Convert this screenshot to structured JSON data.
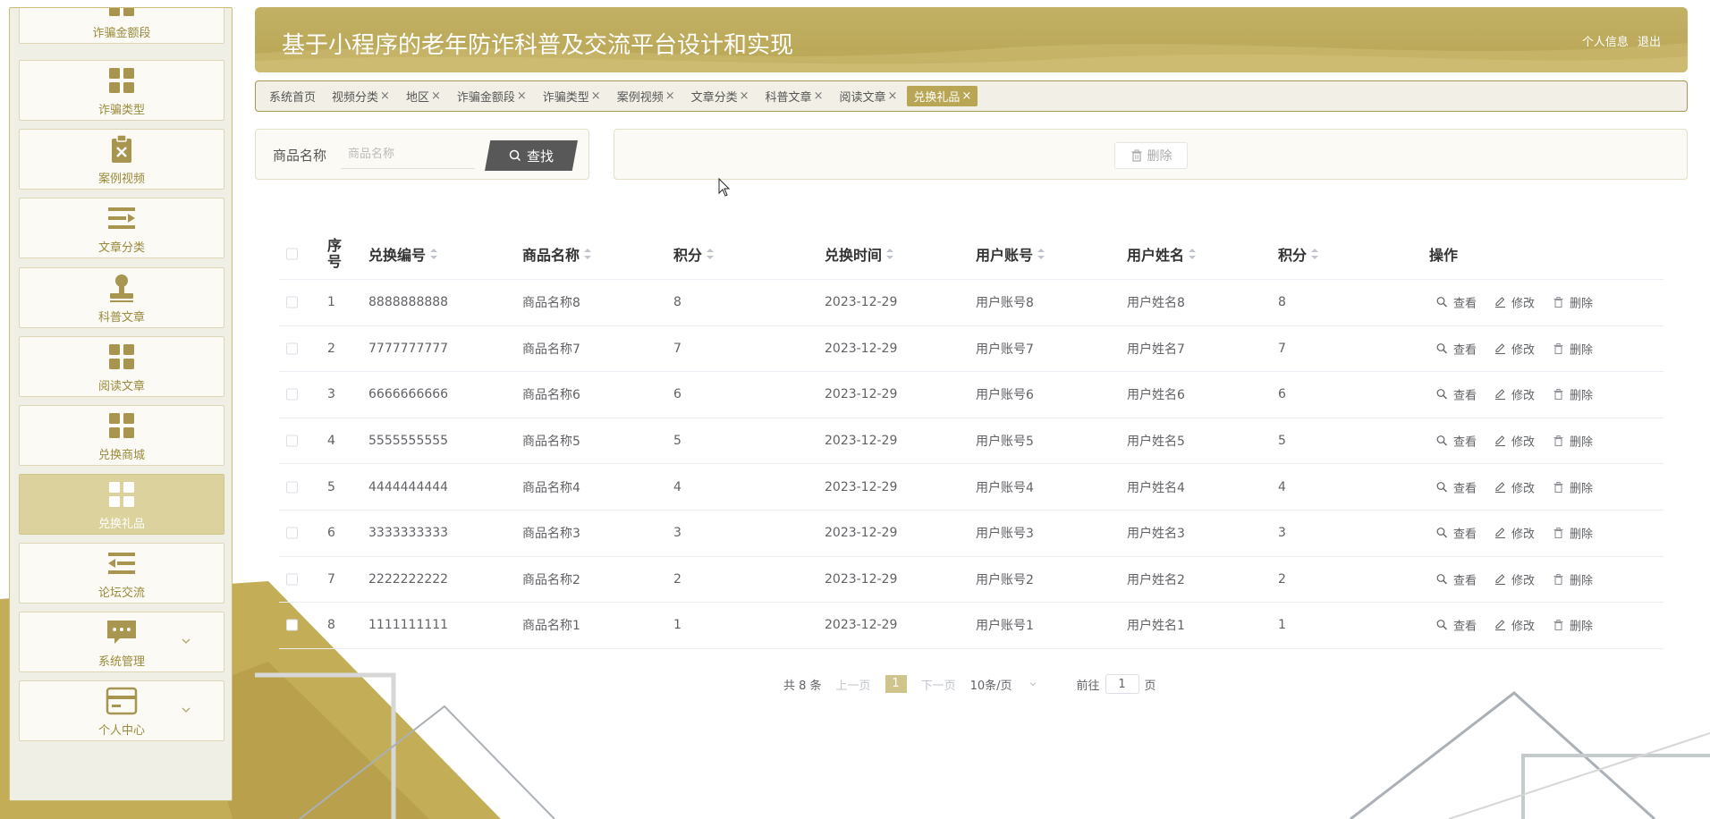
{
  "sidebar": {
    "items": [
      {
        "label": "诈骗金额段",
        "icon": "grid-icon",
        "active": false
      },
      {
        "label": "诈骗类型",
        "icon": "grid-icon",
        "active": false
      },
      {
        "label": "案例视频",
        "icon": "clipboard-x-icon",
        "active": false
      },
      {
        "label": "文章分类",
        "icon": "list-arrow-icon",
        "active": false
      },
      {
        "label": "科普文章",
        "icon": "stamp-icon",
        "active": false
      },
      {
        "label": "阅读文章",
        "icon": "grid-icon",
        "active": false
      },
      {
        "label": "兑换商城",
        "icon": "grid-icon",
        "active": false
      },
      {
        "label": "兑换礼品",
        "icon": "grid-icon",
        "active": true
      },
      {
        "label": "论坛交流",
        "icon": "list-left-arrow-icon",
        "active": false
      },
      {
        "label": "系统管理",
        "icon": "chat-bubble-icon",
        "active": false,
        "expandable": true
      },
      {
        "label": "个人中心",
        "icon": "card-icon",
        "active": false,
        "expandable": true
      }
    ]
  },
  "header": {
    "title": "基于小程序的老年防诈科普及交流平台设计和实现",
    "profile_link": "个人信息",
    "logout_link": "退出"
  },
  "tabs": [
    {
      "label": "系统首页",
      "closable": false,
      "active": false
    },
    {
      "label": "视频分类",
      "closable": true,
      "active": false
    },
    {
      "label": "地区",
      "closable": true,
      "active": false
    },
    {
      "label": "诈骗金额段",
      "closable": true,
      "active": false
    },
    {
      "label": "诈骗类型",
      "closable": true,
      "active": false
    },
    {
      "label": "案例视频",
      "closable": true,
      "active": false
    },
    {
      "label": "文章分类",
      "closable": true,
      "active": false
    },
    {
      "label": "科普文章",
      "closable": true,
      "active": false
    },
    {
      "label": "阅读文章",
      "closable": true,
      "active": false
    },
    {
      "label": "兑换礼品",
      "closable": true,
      "active": true
    }
  ],
  "search": {
    "label": "商品名称",
    "placeholder": "商品名称",
    "button_label": "查找"
  },
  "actions": {
    "delete_label": "删除"
  },
  "table": {
    "columns": [
      "序号",
      "兑换编号",
      "商品名称",
      "积分",
      "兑换时间",
      "用户账号",
      "用户姓名",
      "积分",
      "操作"
    ],
    "rows": [
      {
        "index": "1",
        "code": "8888888888",
        "product": "商品名称8",
        "points": "8",
        "time": "2023-12-29",
        "account": "用户账号8",
        "name": "用户姓名8",
        "points2": "8"
      },
      {
        "index": "2",
        "code": "7777777777",
        "product": "商品名称7",
        "points": "7",
        "time": "2023-12-29",
        "account": "用户账号7",
        "name": "用户姓名7",
        "points2": "7"
      },
      {
        "index": "3",
        "code": "6666666666",
        "product": "商品名称6",
        "points": "6",
        "time": "2023-12-29",
        "account": "用户账号6",
        "name": "用户姓名6",
        "points2": "6"
      },
      {
        "index": "4",
        "code": "5555555555",
        "product": "商品名称5",
        "points": "5",
        "time": "2023-12-29",
        "account": "用户账号5",
        "name": "用户姓名5",
        "points2": "5"
      },
      {
        "index": "5",
        "code": "4444444444",
        "product": "商品名称4",
        "points": "4",
        "time": "2023-12-29",
        "account": "用户账号4",
        "name": "用户姓名4",
        "points2": "4"
      },
      {
        "index": "6",
        "code": "3333333333",
        "product": "商品名称3",
        "points": "3",
        "time": "2023-12-29",
        "account": "用户账号3",
        "name": "用户姓名3",
        "points2": "3"
      },
      {
        "index": "7",
        "code": "2222222222",
        "product": "商品名称2",
        "points": "2",
        "time": "2023-12-29",
        "account": "用户账号2",
        "name": "用户姓名2",
        "points2": "2"
      },
      {
        "index": "8",
        "code": "1111111111",
        "product": "商品名称1",
        "points": "1",
        "time": "2023-12-29",
        "account": "用户账号1",
        "name": "用户姓名1",
        "points2": "1"
      }
    ],
    "ops": {
      "view": "查看",
      "edit": "修改",
      "delete": "删除"
    }
  },
  "pagination": {
    "total_text": "共 8 条",
    "prev": "上一页",
    "current_page": "1",
    "next": "下一页",
    "page_size": "10条/页",
    "goto_label": "前往",
    "goto_value": "1",
    "page_suffix": "页"
  },
  "colors": {
    "accent": "#b9a655",
    "accent_light": "#dcd29d",
    "sidebar_bg": "#f0efe6",
    "dark_button": "#585858"
  }
}
